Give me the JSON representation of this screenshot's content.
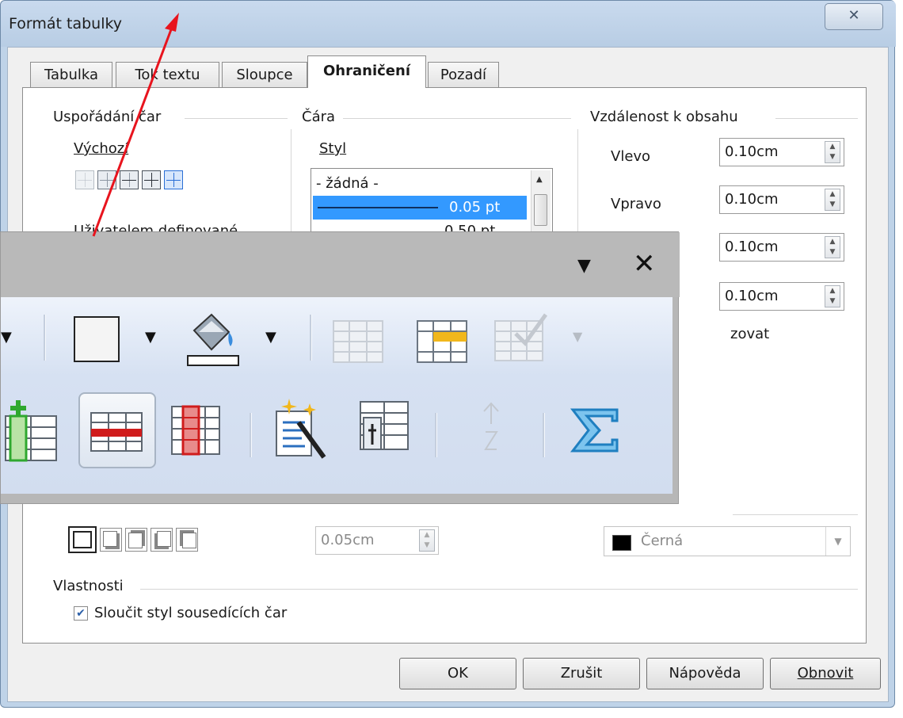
{
  "dialog": {
    "title": "Formát tabulky",
    "close_icon": "close-icon",
    "tabs": [
      {
        "label": "Tabulka"
      },
      {
        "label": "Tok textu"
      },
      {
        "label": "Sloupce"
      },
      {
        "label": "Ohraničení",
        "active": true
      },
      {
        "label": "Pozadí"
      }
    ]
  },
  "line_arrangement": {
    "heading": "Uspořádání čar",
    "default_label": "Výchozí",
    "user_defined_label": "Uživatelem definované"
  },
  "line": {
    "heading": "Čára",
    "style_label": "Styl",
    "style_options": [
      "- žádná -",
      "0.05 pt",
      "0.50 pt"
    ],
    "selected_style": "0.05 pt"
  },
  "spacing": {
    "heading": "Vzdálenost k obsahu",
    "left_label": "Vlevo",
    "left_value": "0.10cm",
    "right_label": "Vpravo",
    "right_value": "0.10cm",
    "top_value": "0.10cm",
    "bottom_value": "0.10cm",
    "sync_label_partial": "zovat"
  },
  "shadow": {
    "width_value": "0.05cm",
    "color_value": "Černá",
    "color_swatch": "#000000"
  },
  "properties": {
    "heading": "Vlastnosti",
    "merge_label": "Sloučit styl sousedících čar",
    "merge_checked": true
  },
  "buttons": {
    "ok": "OK",
    "cancel": "Zrušit",
    "help": "Nápověda",
    "reset": "Obnovit"
  },
  "toolbar": {
    "row1_icons": [
      "dropdown-arrow-icon",
      "border-style-icon",
      "dropdown-arrow-icon",
      "fill-bucket-icon",
      "dropdown-arrow-icon",
      "merge-cells-icon",
      "split-cells-icon",
      "optimize-table-icon",
      "dropdown-arrow-icon"
    ],
    "row2_icons": [
      "insert-column-icon",
      "delete-row-icon",
      "delete-column-icon",
      "autoformat-icon",
      "table-properties-icon",
      "sort-icon",
      "sum-icon"
    ]
  },
  "colors": {
    "accent": "#3399ff",
    "arrow": "#e8141e",
    "insert_green": "#2fa82f",
    "delete_red": "#d01c1c",
    "sum_blue": "#1f7fc0"
  }
}
